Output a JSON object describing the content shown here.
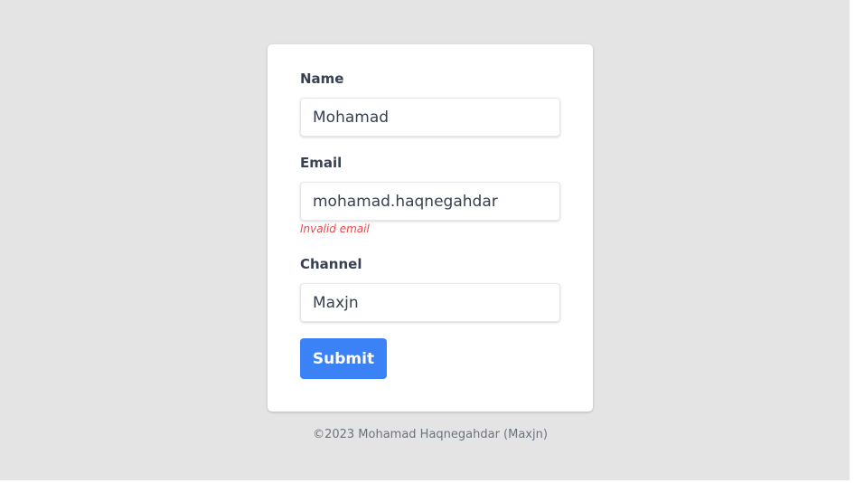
{
  "form": {
    "name_label": "Name",
    "name_value": "Mohamad",
    "email_label": "Email",
    "email_value": "mohamad.haqnegahdar",
    "email_error": "Invalid email",
    "channel_label": "Channel",
    "channel_value": "Maxjn",
    "submit_label": "Submit"
  },
  "footer": {
    "text": "©2023 Mohamad Haqnegahdar (Maxjn)"
  },
  "colors": {
    "page_background": "#e4e4e4",
    "card_background": "#ffffff",
    "accent": "#3b82f6",
    "error": "#ef4444",
    "text": "#374151"
  }
}
